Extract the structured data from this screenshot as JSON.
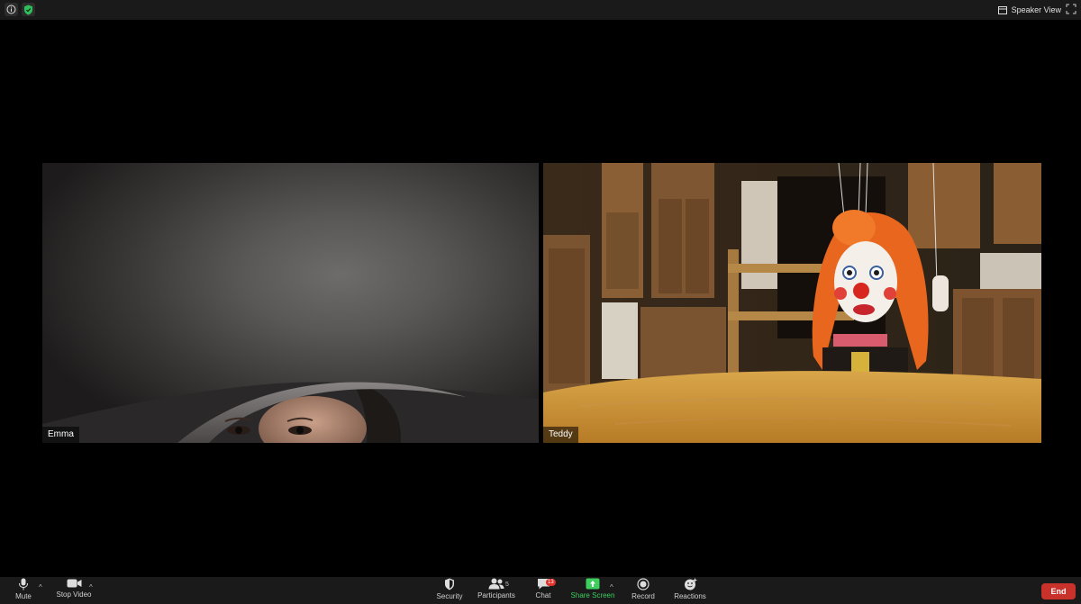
{
  "topbar": {
    "info_icon": "info-icon",
    "shield_icon": "shield-icon",
    "view_label": "Speaker View",
    "fullscreen_icon": "fullscreen-icon"
  },
  "participants": [
    {
      "name": "Emma"
    },
    {
      "name": "Teddy"
    }
  ],
  "toolbar": {
    "mute": "Mute",
    "stop_video": "Stop Video",
    "security": "Security",
    "participants": "Participants",
    "participant_count": "5",
    "chat": "Chat",
    "chat_badge": "13",
    "share_screen": "Share Screen",
    "record": "Record",
    "reactions": "Reactions",
    "end": "End"
  },
  "colors": {
    "share_green": "#3ccf5e",
    "end_red": "#c8322b",
    "badge_red": "#e0312b"
  }
}
